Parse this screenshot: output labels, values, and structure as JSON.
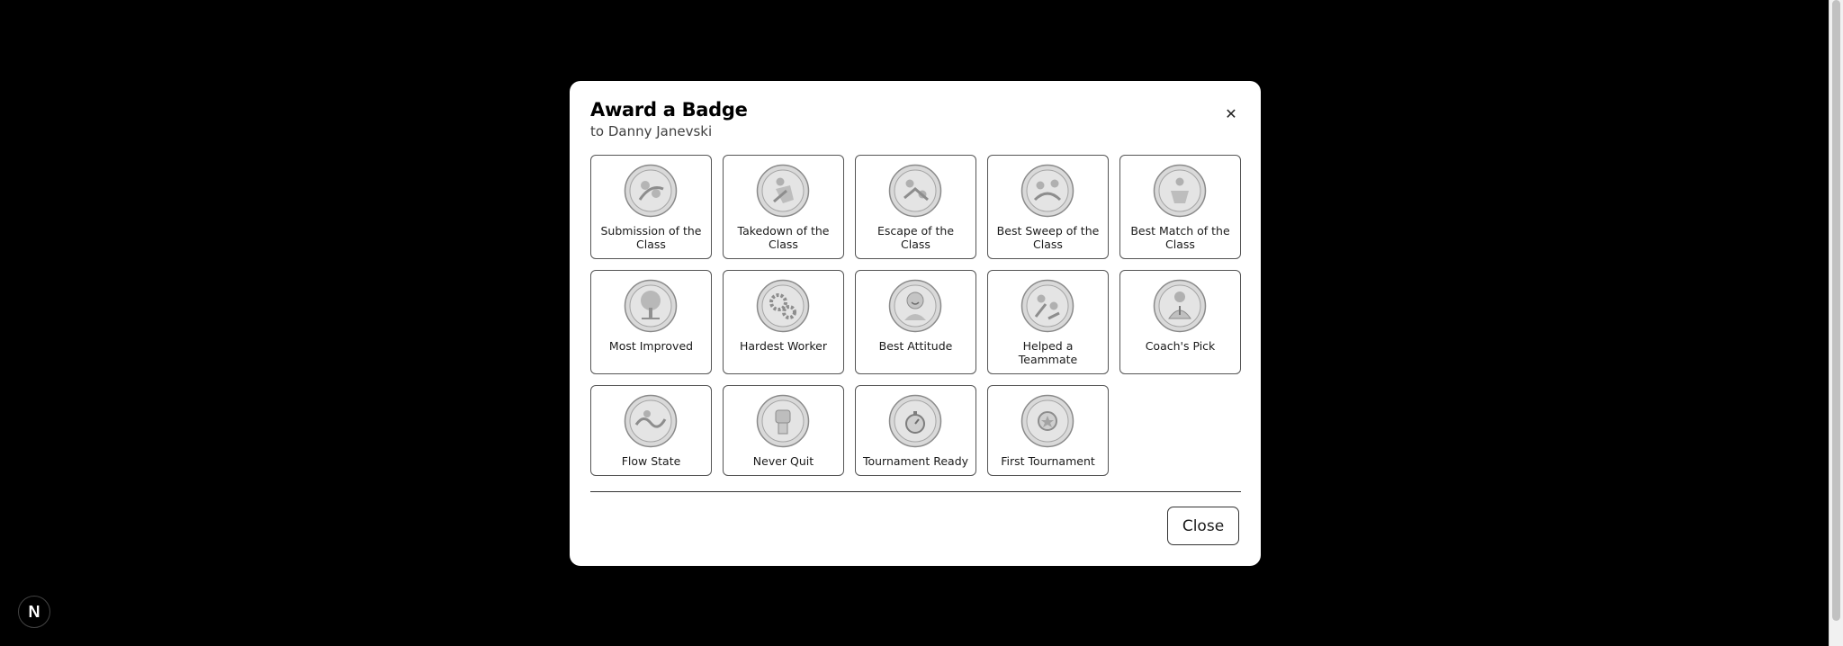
{
  "modal": {
    "title": "Award a Badge",
    "subtitle": "to Danny Janevski",
    "close_icon": "close-icon",
    "close_button_label": "Close"
  },
  "badges": [
    {
      "label": "Submission of the Class",
      "icon": "submission-badge-icon"
    },
    {
      "label": "Takedown of the Class",
      "icon": "takedown-badge-icon"
    },
    {
      "label": "Escape of the Class",
      "icon": "escape-badge-icon"
    },
    {
      "label": "Best Sweep of the Class",
      "icon": "sweep-badge-icon"
    },
    {
      "label": "Best Match of the Class",
      "icon": "match-badge-icon"
    },
    {
      "label": "Most Improved",
      "icon": "tree-badge-icon"
    },
    {
      "label": "Hardest Worker",
      "icon": "gears-badge-icon"
    },
    {
      "label": "Best Attitude",
      "icon": "smiling-face-badge-icon"
    },
    {
      "label": "Helped a Teammate",
      "icon": "teammates-badge-icon"
    },
    {
      "label": "Coach's Pick",
      "icon": "coach-badge-icon"
    },
    {
      "label": "Flow State",
      "icon": "flow-badge-icon"
    },
    {
      "label": "Never Quit",
      "icon": "fist-badge-icon"
    },
    {
      "label": "Tournament Ready",
      "icon": "stopwatch-badge-icon"
    },
    {
      "label": "First Tournament",
      "icon": "medal-badge-icon"
    }
  ],
  "colors": {
    "backdrop": "#000000",
    "modal_bg": "#ffffff",
    "badge_fill": "#d9d9d9",
    "badge_stroke": "#8a8a8a"
  },
  "dev_indicator": {
    "letter": "N"
  }
}
